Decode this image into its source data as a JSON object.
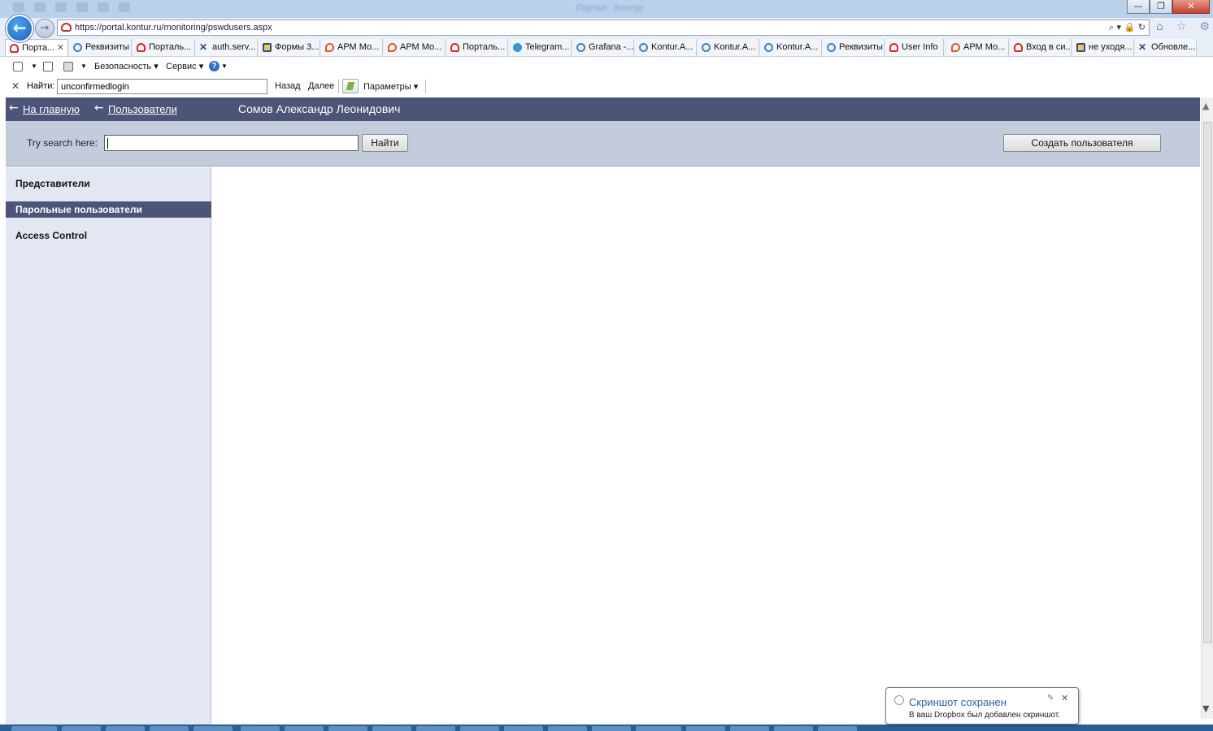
{
  "browser": {
    "window_title": "Портал · Контур",
    "address_url": "https://portal.kontur.ru/monitoring/pswdusers.aspx",
    "tabs": [
      {
        "label": "Порта...",
        "favicon": "kontur-icon"
      },
      {
        "label": "Реквизиты",
        "favicon": "ie-icon"
      },
      {
        "label": "Порталь...",
        "favicon": "kontur-icon"
      },
      {
        "label": "auth.serv...",
        "favicon": "cross-icon"
      },
      {
        "label": "Формы 3...",
        "favicon": "forms-icon"
      },
      {
        "label": "АРМ Мо...",
        "favicon": "arm-icon"
      },
      {
        "label": "АРМ Мо...",
        "favicon": "arm-icon"
      },
      {
        "label": "Порталь...",
        "favicon": "kontur-icon"
      },
      {
        "label": "Telegram...",
        "favicon": "telegram-icon"
      },
      {
        "label": "Grafana -...",
        "favicon": "ie-icon"
      },
      {
        "label": "Kontur.A...",
        "favicon": "ie-icon"
      },
      {
        "label": "Kontur.A...",
        "favicon": "ie-icon"
      },
      {
        "label": "Kontur.A...",
        "favicon": "ie-icon"
      },
      {
        "label": "Реквизиты",
        "favicon": "ie-icon"
      },
      {
        "label": "User Info",
        "favicon": "kontur-icon"
      },
      {
        "label": "АРМ Мо...",
        "favicon": "arm-icon"
      },
      {
        "label": "Вход в си...",
        "favicon": "kontur-icon"
      },
      {
        "label": "не уходя...",
        "favicon": "forms-icon"
      },
      {
        "label": "Обновле...",
        "favicon": "cross-icon"
      }
    ],
    "commands": {
      "security": "Безопасность",
      "service": "Сервис"
    },
    "find": {
      "label": "Найти:",
      "value": "unconfirmedlogin",
      "back": "Назад",
      "next": "Далее",
      "params": "Параметры"
    }
  },
  "page": {
    "header": {
      "home_link": "На главную",
      "users_link": "Пользователи",
      "title": "Сомов Александр Леонидович"
    },
    "search": {
      "label": "Try search here:",
      "value": "",
      "button": "Найти",
      "create_button": "Создать пользователя"
    },
    "sidebar": {
      "items": [
        {
          "label": "Представители",
          "active": false
        },
        {
          "label": "Парольные пользователи",
          "active": true
        },
        {
          "label": "Access Control",
          "active": false
        }
      ]
    }
  },
  "notification": {
    "title": "Скриншот сохранен",
    "body": "В ваш Dropbox был добавлен скриншот."
  },
  "colors": {
    "header_bg": "#4b5577",
    "search_bg": "#c4ccdb",
    "sidebar_bg": "#e3e7f1",
    "active_item_bg": "#4b5577"
  }
}
